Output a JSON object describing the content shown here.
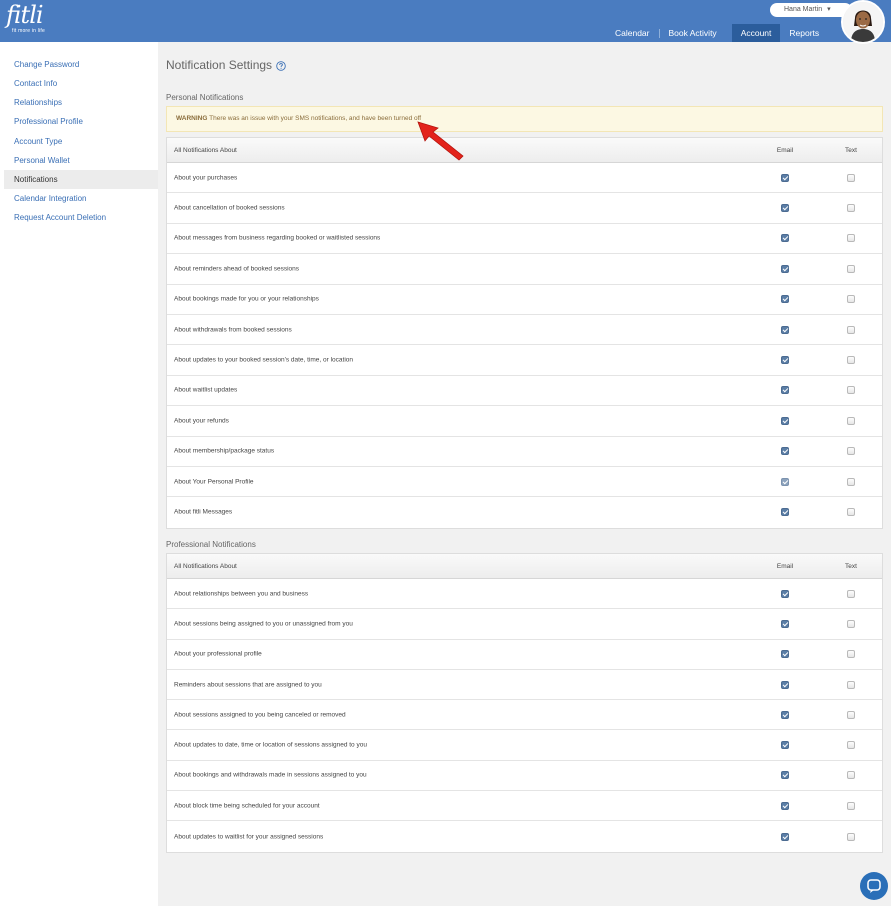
{
  "header": {
    "logo_text": "fitli",
    "logo_tagline": "fit more in life",
    "user_name": "Hana Martin",
    "user_caret": "▾",
    "nav": [
      {
        "label": "Calendar"
      },
      {
        "label": "Book Activity"
      },
      {
        "label": "Account"
      },
      {
        "label": "Reports"
      }
    ],
    "active_nav": "Account"
  },
  "sidebar": {
    "items": [
      {
        "label": "Change Password"
      },
      {
        "label": "Contact Info"
      },
      {
        "label": "Relationships"
      },
      {
        "label": "Professional Profile"
      },
      {
        "label": "Account Type"
      },
      {
        "label": "Personal Wallet"
      },
      {
        "label": "Notifications"
      },
      {
        "label": "Calendar Integration"
      },
      {
        "label": "Request Account Deletion"
      }
    ],
    "active_item": "Notifications"
  },
  "main": {
    "title": "Notification Settings",
    "personal": {
      "title": "Personal Notifications",
      "warning_label": "WARNING",
      "warning_text": "There was an issue with your SMS notifications, and have been turned off",
      "header_label": "All Notifications About",
      "header_email": "Email",
      "header_text": "Text",
      "rows": [
        {
          "label": "About your purchases",
          "email": true,
          "text": false
        },
        {
          "label": "About cancellation of booked sessions",
          "email": true,
          "text": false
        },
        {
          "label": "About messages from business regarding booked or waitlisted sessions",
          "email": true,
          "text": false
        },
        {
          "label": "About reminders ahead of booked sessions",
          "email": true,
          "text": false
        },
        {
          "label": "About bookings made for you or your relationships",
          "email": true,
          "text": false
        },
        {
          "label": "About withdrawals from booked sessions",
          "email": true,
          "text": false
        },
        {
          "label": "About updates to your booked session's date, time, or location",
          "email": true,
          "text": false
        },
        {
          "label": "About waitlist updates",
          "email": true,
          "text": false
        },
        {
          "label": "About your refunds",
          "email": true,
          "text": false
        },
        {
          "label": "About membership/package status",
          "email": true,
          "text": false
        },
        {
          "label": "About Your Personal Profile",
          "email": true,
          "text": false
        },
        {
          "label": "About fitli Messages",
          "email": true,
          "text": false
        }
      ]
    },
    "professional": {
      "title": "Professional Notifications",
      "header_label": "All Notifications About",
      "header_email": "Email",
      "header_text": "Text",
      "rows": [
        {
          "label": "About relationships between you and business",
          "email": true,
          "text": false
        },
        {
          "label": "About sessions being assigned to you or unassigned from you",
          "email": true,
          "text": false
        },
        {
          "label": "About your professional profile",
          "email": true,
          "text": false
        },
        {
          "label": "Reminders about sessions that are assigned to you",
          "email": true,
          "text": false
        },
        {
          "label": "About sessions assigned to you being canceled or removed",
          "email": true,
          "text": false
        },
        {
          "label": "About updates to date, time or location of sessions assigned to you",
          "email": true,
          "text": false
        },
        {
          "label": "About bookings and withdrawals made in sessions assigned to you",
          "email": true,
          "text": false
        },
        {
          "label": "About block time being scheduled for your account",
          "email": true,
          "text": false
        },
        {
          "label": "About updates to waitlist for your assigned sessions",
          "email": true,
          "text": false
        }
      ]
    }
  },
  "colors": {
    "header_bg": "#4a7cc0",
    "nav_active_bg": "#2b5d9c",
    "link": "#3a6fb5",
    "checkbox_checked": "#5b7ea6",
    "warning_bg": "#fcf8e3",
    "annotation_arrow": "#e3231b"
  },
  "icons": {
    "help": "question-circle-icon",
    "annotation": "red-arrow-icon",
    "chat": "chat-bubble-icon",
    "avatar": "user-avatar"
  }
}
